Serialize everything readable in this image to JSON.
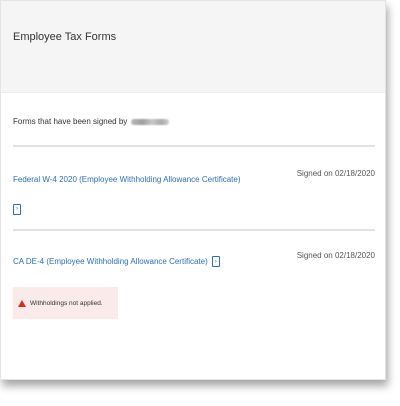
{
  "header": {
    "title": "Employee Tax Forms"
  },
  "signed_section": {
    "label": "Forms that have been signed by"
  },
  "forms": [
    {
      "name": "Federal W-4 2020 (Employee Withholding Allowance Certificate)",
      "signed_text": "Signed on 02/18/2020",
      "icon": "document-link-icon"
    },
    {
      "name": "CA DE-4 (Employee Withholding Allowance Certificate)",
      "signed_text": "Signed on 02/18/2020",
      "icon": "document-link-icon",
      "alert": {
        "text": "Withholdings not applied.",
        "icon": "warning-icon",
        "color": "#d62d20"
      }
    }
  ],
  "colors": {
    "link": "#2f6fb3",
    "header_bg": "#f5f5f5",
    "alert_bg": "#fbeaea",
    "warning": "#d62d20"
  }
}
